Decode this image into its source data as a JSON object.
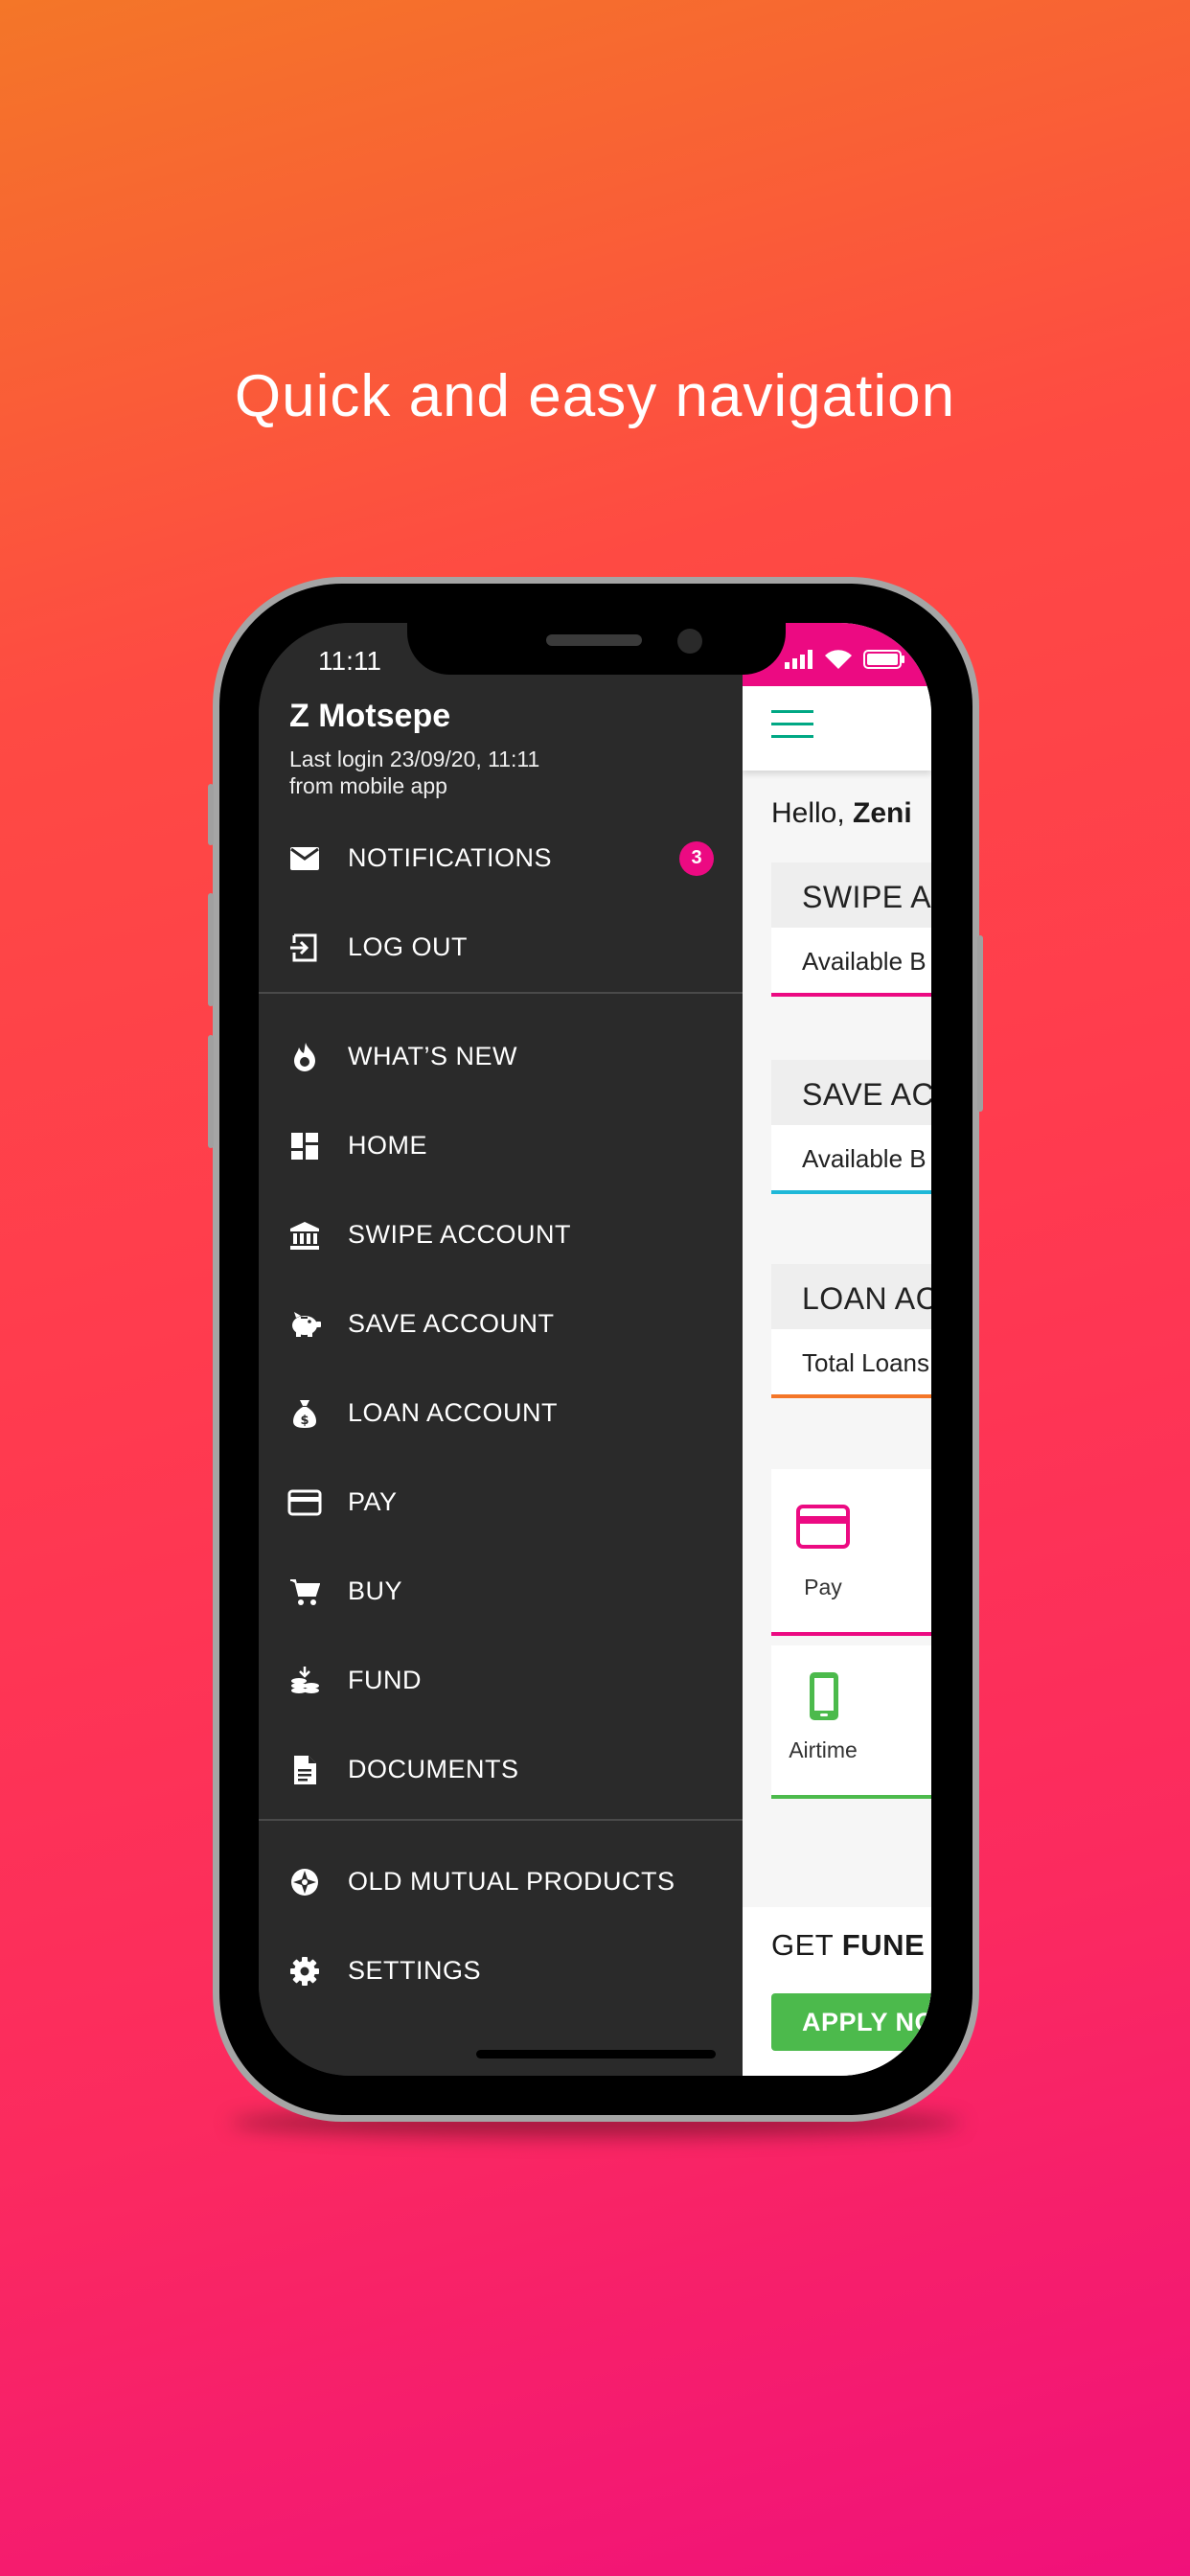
{
  "headline": "Quick and easy navigation",
  "status_bar": {
    "time": "11:11"
  },
  "drawer": {
    "user_name": "Z Motsepe",
    "last_login_line1": "Last login 23/09/20, 11:11",
    "last_login_line2": "from mobile app",
    "notifications_count": "3",
    "items": [
      {
        "label": "NOTIFICATIONS",
        "icon": "mail-icon"
      },
      {
        "label": "LOG OUT",
        "icon": "logout-icon"
      },
      {
        "label": "WHAT’S NEW",
        "icon": "flame-icon"
      },
      {
        "label": "HOME",
        "icon": "dashboard-icon"
      },
      {
        "label": "SWIPE ACCOUNT",
        "icon": "bank-icon"
      },
      {
        "label": "SAVE ACCOUNT",
        "icon": "piggy-bank-icon"
      },
      {
        "label": "LOAN ACCOUNT",
        "icon": "money-bag-icon"
      },
      {
        "label": "PAY",
        "icon": "credit-card-icon"
      },
      {
        "label": "BUY",
        "icon": "cart-icon"
      },
      {
        "label": "FUND",
        "icon": "coins-icon"
      },
      {
        "label": "DOCUMENTS",
        "icon": "document-icon"
      },
      {
        "label": "OLD MUTUAL PRODUCTS",
        "icon": "old-mutual-logo-icon"
      },
      {
        "label": "SETTINGS",
        "icon": "gear-icon"
      }
    ]
  },
  "main": {
    "hello_prefix": "Hello,",
    "hello_name": "Zeni",
    "cards": [
      {
        "title": "SWIPE A",
        "body": "Available B",
        "color": "#ec0a82"
      },
      {
        "title": "SAVE AC",
        "body": "Available B",
        "color": "#1fb8d8"
      },
      {
        "title": "LOAN AC",
        "body": "Total Loans",
        "color": "#f47628"
      }
    ],
    "tiles": [
      {
        "label": "Pay",
        "icon": "credit-card-icon",
        "color": "#ec0a82"
      },
      {
        "label": "Airtime",
        "icon": "mobile-phone-icon",
        "color": "#4cba4c"
      }
    ],
    "get_prefix": "GET",
    "get_bold": "FUNE",
    "apply_label": "APPLY NO"
  },
  "colors": {
    "accent_pink": "#ec0a82",
    "teal": "#00a884",
    "green": "#4cba4c",
    "blue": "#1fb8d8",
    "orange": "#f47628",
    "drawer_bg": "#2a2a2a"
  }
}
